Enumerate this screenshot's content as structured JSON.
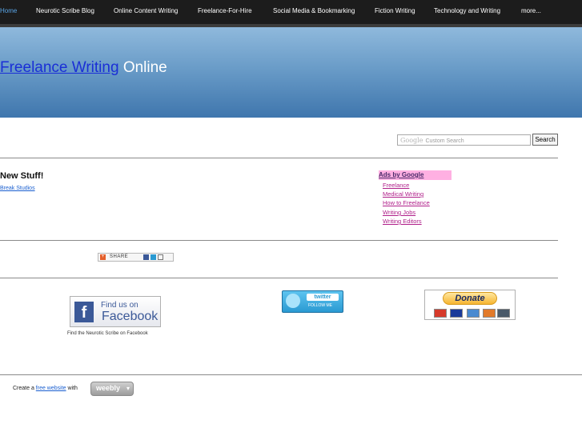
{
  "nav": {
    "items": [
      {
        "label": "Home",
        "active": true
      },
      {
        "label": "Neurotic Scribe Blog"
      },
      {
        "label": "Online Content Writing"
      },
      {
        "label": "Freelance-For-Hire"
      },
      {
        "label": "Social Media & Bookmarking"
      },
      {
        "label": "Fiction Writing"
      },
      {
        "label": "Technology and Writing"
      },
      {
        "label": "more..."
      }
    ]
  },
  "header": {
    "title_link": "Freelance Writing",
    "title_rest": " Online"
  },
  "search": {
    "brand": "Google",
    "placeholder": "Custom Search",
    "button_label": "Search"
  },
  "content": {
    "heading": "New Stuff!",
    "link": "Break Studios"
  },
  "ads": {
    "heading": "Ads by Google",
    "links": [
      "Freelance",
      "Medical Writing",
      "How to Freelance",
      "Writing Jobs",
      "Writing Editors"
    ]
  },
  "share": {
    "label": "SHARE"
  },
  "facebook": {
    "line1": "Find us on",
    "line2": "Facebook",
    "caption": "Find the Neurotic Scribe on Facebook"
  },
  "twitter": {
    "word": "twitter",
    "follow": "FOLLOW ME"
  },
  "donate": {
    "label": "Donate"
  },
  "footer": {
    "prefix": "Create a ",
    "link": "free website",
    "suffix": " with",
    "badge": "weebly"
  },
  "colors": {
    "accent": "#5aa6e8",
    "facebook": "#3b5998",
    "ads_bg": "#ffb0e2",
    "ad_link": "#b0208a"
  }
}
